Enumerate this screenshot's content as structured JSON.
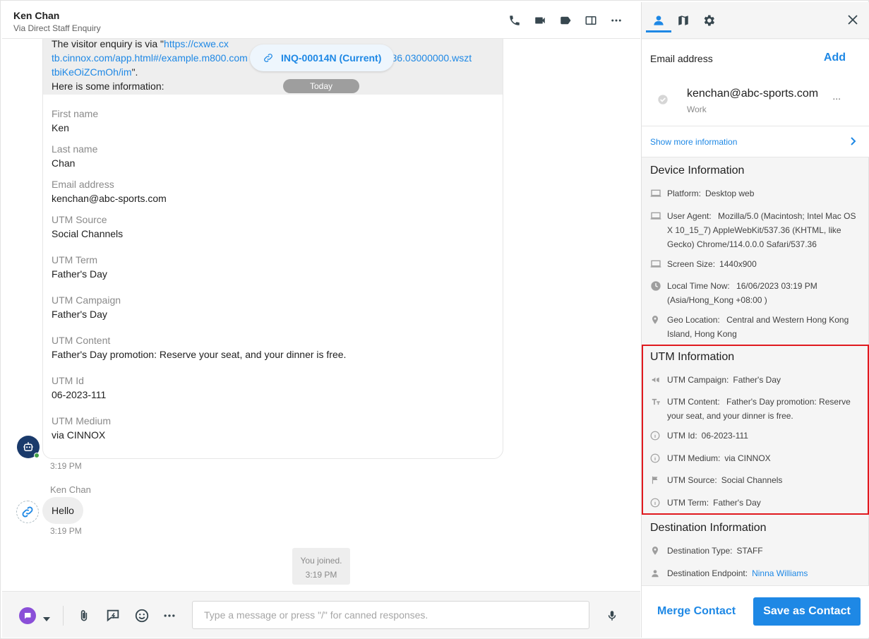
{
  "header": {
    "name": "Ken Chan",
    "subtitle": "Via Direct Staff Enquiry",
    "icons": [
      "phone-icon",
      "video-icon",
      "tag-icon",
      "split-view-icon",
      "more-icon"
    ]
  },
  "inquiry_pill": {
    "label": "INQ-00014N (Current)"
  },
  "today_label": "Today",
  "bot_message": {
    "line1_prefix": "The visitor enquiry is via \"",
    "line1_link": "https://cxwe.cx",
    "line2_link_a": "tb.cinnox.com/app.html#/example.m800.com",
    "line2_link_b": "J.1386.03000000.wszt",
    "line3_link": "tbiKeOiZCmOh/im",
    "line3_suffix": "\".",
    "line4": "Here is some information:",
    "fields": [
      {
        "label": "First name",
        "value": "Ken"
      },
      {
        "label": "Last name",
        "value": "Chan"
      },
      {
        "label": "Email address",
        "value": "kenchan@abc-sports.com"
      },
      {
        "label": "UTM Source",
        "value": "Social Channels"
      },
      {
        "label": "UTM Term",
        "value": "Father's Day"
      },
      {
        "label": "UTM Campaign",
        "value": "Father's Day"
      },
      {
        "label": "UTM Content",
        "value": "Father's Day promotion: Reserve your seat, and your dinner is free."
      },
      {
        "label": "UTM Id",
        "value": "06-2023-111"
      },
      {
        "label": "UTM Medium",
        "value": "via CINNOX"
      }
    ],
    "time": "3:19 PM"
  },
  "visitor_message": {
    "sender": "Ken Chan",
    "text": "Hello",
    "time": "3:19 PM"
  },
  "system_message": {
    "line1": "You joined.",
    "line2": "3:19 PM"
  },
  "composer": {
    "placeholder": "Type a message or press \"/\" for canned responses.",
    "value": ""
  },
  "panel": {
    "tabs": [
      "person-icon",
      "map-icon",
      "gear-icon"
    ],
    "email": {
      "title": "Email address",
      "add_label": "Add",
      "address": "kenchan@abc-sports.com",
      "type": "Work",
      "more": "..."
    },
    "show_more": "Show more information",
    "device": {
      "title": "Device Information",
      "rows": [
        {
          "icon": "laptop-icon",
          "label": "Platform:",
          "value": "Desktop web"
        },
        {
          "icon": "laptop-icon",
          "label": "User Agent:",
          "value": "Mozilla/5.0 (Macintosh; Intel Mac OS X 10_15_7) AppleWebKit/537.36 (KHTML, like Gecko) Chrome/114.0.0.0 Safari/537.36"
        },
        {
          "icon": "laptop-icon",
          "label": "Screen Size:",
          "value": "1440x900"
        },
        {
          "icon": "clock-icon",
          "label": "Local Time Now:",
          "value": "16/06/2023 03:19 PM (Asia/Hong_Kong +08:00 )"
        },
        {
          "icon": "location-pin-icon",
          "label": "Geo Location:",
          "value": "Central and Western Hong Kong Island, Hong Kong"
        }
      ]
    },
    "utm": {
      "title": "UTM Information",
      "rows": [
        {
          "icon": "megaphone-icon",
          "label": "UTM Campaign:",
          "value": "Father's Day"
        },
        {
          "icon": "text-size-icon",
          "label": "UTM Content:",
          "value": "Father's Day promotion: Reserve your seat, and your dinner is free."
        },
        {
          "icon": "info-icon",
          "label": "UTM Id:",
          "value": "06-2023-111"
        },
        {
          "icon": "info-icon",
          "label": "UTM Medium:",
          "value": "via CINNOX"
        },
        {
          "icon": "flag-icon",
          "label": "UTM Source:",
          "value": "Social Channels"
        },
        {
          "icon": "info-icon",
          "label": "UTM Term:",
          "value": "Father's Day"
        }
      ]
    },
    "destination": {
      "title": "Destination Information",
      "rows": [
        {
          "icon": "location-pin-icon",
          "label": "Destination Type:",
          "value": "STAFF"
        },
        {
          "icon": "person-icon",
          "label": "Destination Endpoint:",
          "value": "Ninna Williams"
        }
      ]
    },
    "footer": {
      "merge_label": "Merge Contact",
      "save_label": "Save as Contact"
    }
  },
  "colors": {
    "accent": "#1e88e5",
    "highlight_border": "#e0191e",
    "bot_avatar": "#1a3a6b",
    "channel": "#8a4fd8"
  }
}
